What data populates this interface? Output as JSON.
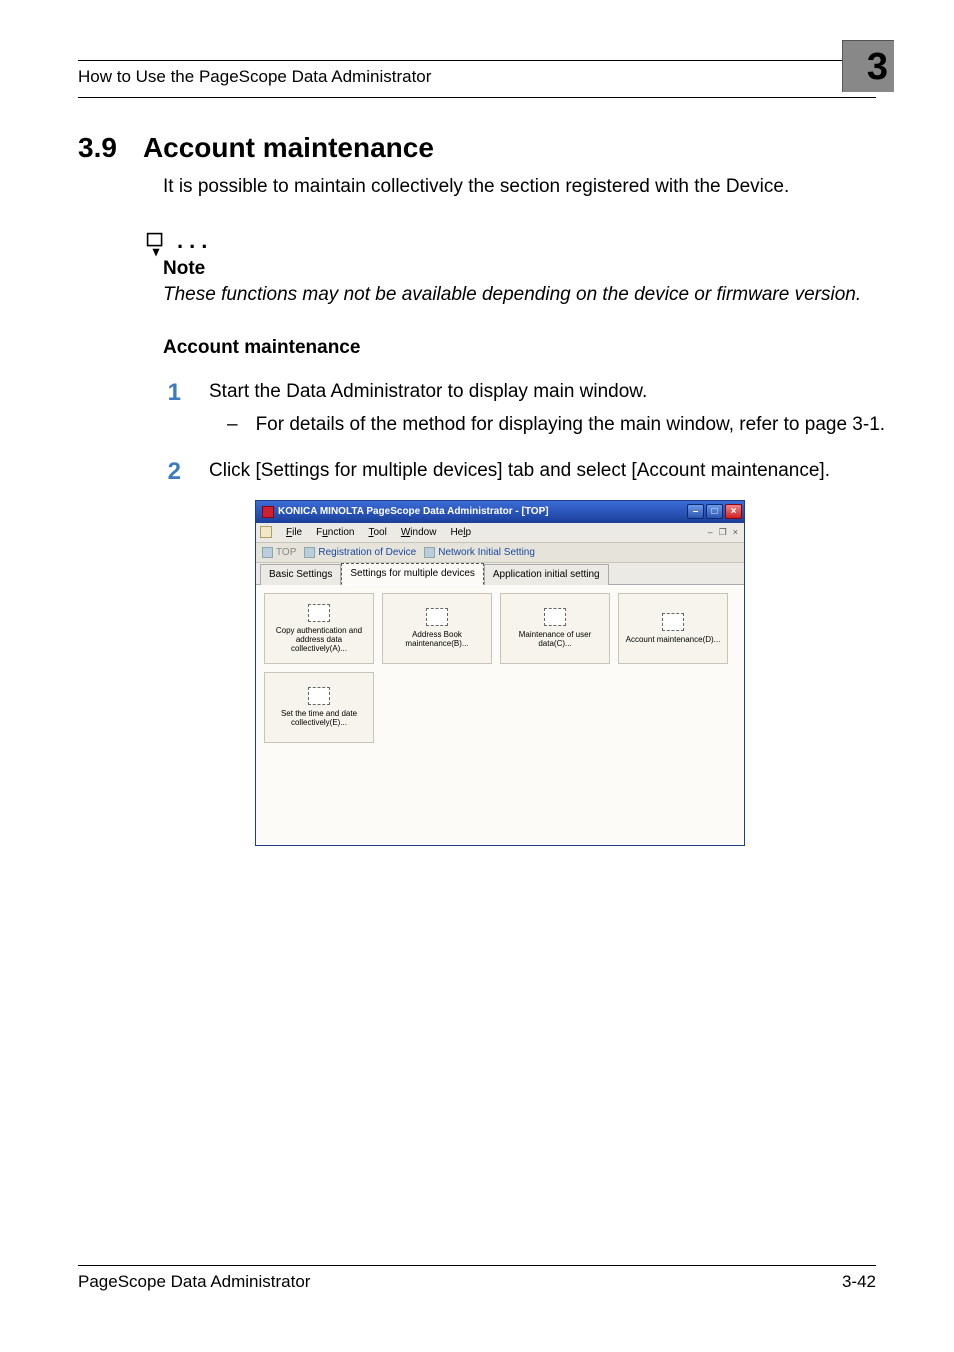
{
  "page": {
    "running_head": "How to Use the PageScope Data Administrator",
    "chapter_corner": "3",
    "footer_left": "PageScope Data Administrator",
    "footer_right": "3-42"
  },
  "section": {
    "number": "3.9",
    "title": "Account maintenance",
    "intro": "It is possible to maintain collectively the section registered with the Device."
  },
  "note": {
    "label": "Note",
    "body": "These functions may not be available depending on the device or firmware version."
  },
  "procedure": {
    "subhead": "Account maintenance",
    "steps": [
      {
        "no": "1",
        "text": "Start the Data Administrator to display main window.",
        "sub": "For details of the method for displaying the main window, refer to page 3-1."
      },
      {
        "no": "2",
        "text": "Click [Settings for multiple devices] tab and select [Account maintenance]."
      }
    ]
  },
  "app": {
    "title": "KONICA MINOLTA PageScope Data Administrator - [TOP]",
    "menus": {
      "file": "File",
      "function": "Function",
      "tool": "Tool",
      "window": "Window",
      "help": "Help"
    },
    "doc_ctrl": {
      "min": "–",
      "restore": "❐",
      "close": "×"
    },
    "toolbar": {
      "top": "TOP",
      "reg": "Registration of Device",
      "net": "Network Initial Setting"
    },
    "tabs": {
      "basic": "Basic Settings",
      "multi": "Settings for multiple devices",
      "appinit": "Application initial setting"
    },
    "tiles": {
      "copyauth": "Copy authentication and address data collectively(A)...",
      "abook": "Address Book maintenance(B)...",
      "user": "Maintenance of user data(C)...",
      "account": "Account maintenance(D)...",
      "time": "Set the time and date collectively(E)..."
    }
  }
}
